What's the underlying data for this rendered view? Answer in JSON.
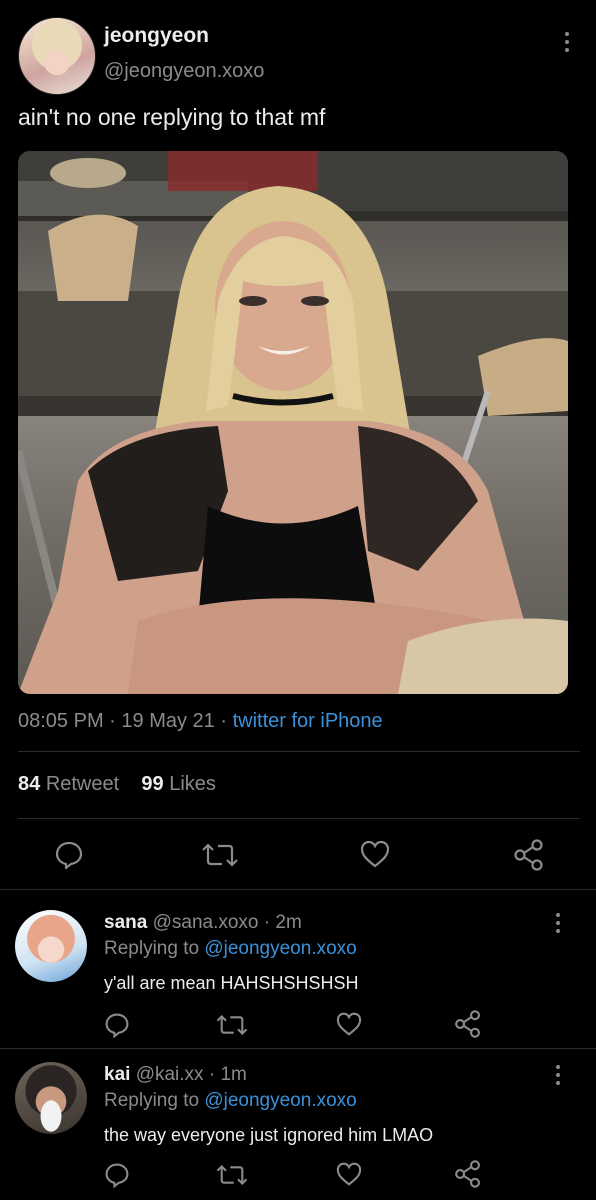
{
  "tweet": {
    "name": "jeongyeon",
    "handle": "@jeongyeon.xoxo",
    "text": "ain't no one replying to that mf",
    "time": "08:05 PM",
    "date": "19 May 21",
    "source": "twitter for iPhone",
    "retweet_count": "84",
    "retweet_label": "Retweet",
    "like_count": "99",
    "like_label": "Likes"
  },
  "replies": [
    {
      "name": "sana",
      "handle": "@sana.xoxo",
      "time": "2m",
      "replying_label": "Replying to",
      "replying_to": "@jeongyeon.xoxo",
      "text": "y'all are mean HAHSHSHSHSH"
    },
    {
      "name": "kai",
      "handle": "@kai.xx",
      "time": "1m",
      "replying_label": "Replying to",
      "replying_to": "@jeongyeon.xoxo",
      "text": "the way everyone just ignored him LMAO"
    }
  ],
  "separator": "·",
  "colors": {
    "background": "#000000",
    "accent": "#3b91d9",
    "muted": "#8b8b8b"
  }
}
